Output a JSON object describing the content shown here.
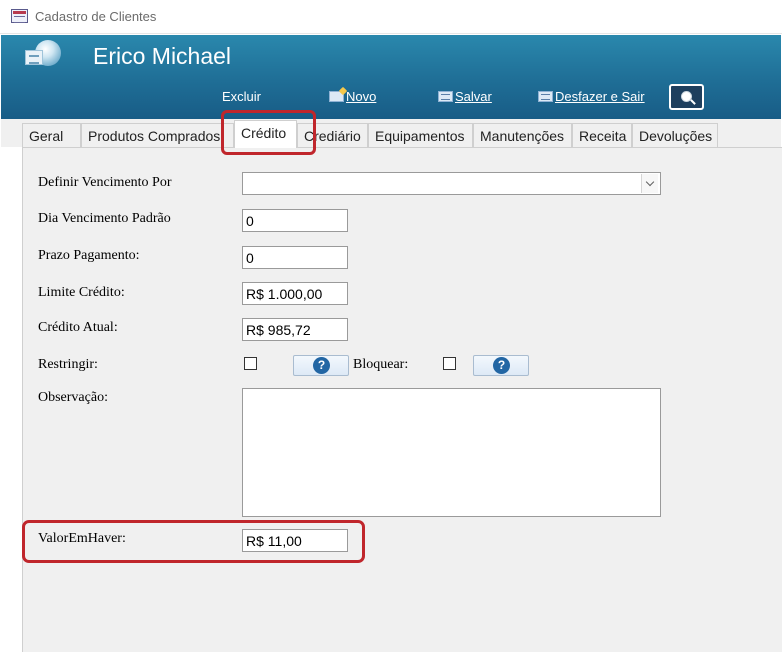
{
  "window": {
    "title": "Cadastro de Clientes",
    "title_icon": "form-icon"
  },
  "header": {
    "client_name": "Erico Michael",
    "buttons": {
      "delete": "Excluir",
      "new": "Novo",
      "save": "Salvar",
      "undo_exit": "Desfazer e Sair"
    },
    "colors": {
      "header_top": "#2a88ad",
      "header_bottom": "#185c86"
    }
  },
  "tabs": [
    {
      "label": "Geral"
    },
    {
      "label": "Produtos Comprados"
    },
    {
      "label": "Crédito",
      "active": true
    },
    {
      "label": "Crediário"
    },
    {
      "label": "Equipamentos"
    },
    {
      "label": "Manutenções"
    },
    {
      "label": "Receita"
    },
    {
      "label": "Devoluções"
    }
  ],
  "form": {
    "vencimento_por": {
      "label": "Definir Vencimento Por",
      "value": ""
    },
    "dia_vencimento": {
      "label": "Dia Vencimento Padrão",
      "value": "0"
    },
    "prazo_pagamento": {
      "label": "Prazo Pagamento:",
      "value": "0"
    },
    "limite_credito": {
      "label": "Limite Crédito:",
      "value": "R$ 1.000,00"
    },
    "credito_atual": {
      "label": "Crédito Atual:",
      "value": "R$ 985,72"
    },
    "restringir": {
      "label": "Restringir:",
      "checked": false,
      "help": "?"
    },
    "bloquear": {
      "label": "Bloquear:",
      "checked": false,
      "help": "?"
    },
    "observacao": {
      "label": "Observação:",
      "value": ""
    },
    "valor_em_haver": {
      "label": "ValorEmHaver:",
      "value": "R$ 11,00"
    }
  },
  "highlight_color": "#c0262c"
}
